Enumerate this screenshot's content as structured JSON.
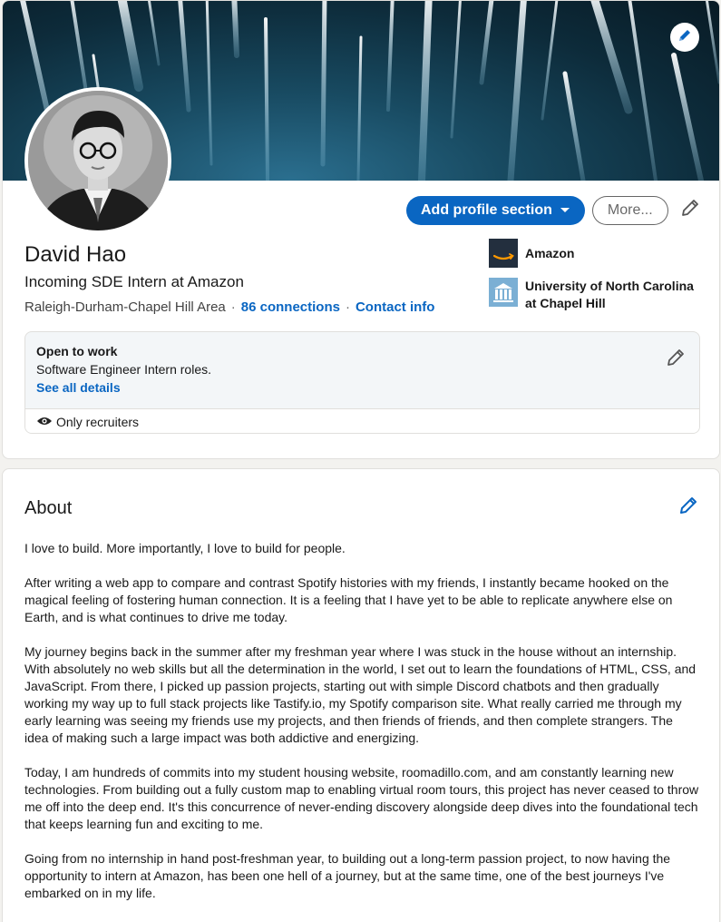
{
  "profile": {
    "name": "David Hao",
    "headline": "Incoming SDE Intern at Amazon",
    "location": "Raleigh-Durham-Chapel Hill Area",
    "connections": "86 connections",
    "contact_info": "Contact info"
  },
  "actions": {
    "add_section": "Add profile section",
    "more": "More..."
  },
  "orgs": [
    {
      "name": "Amazon",
      "icon": "amazon-logo"
    },
    {
      "name": "University of North Carolina at Chapel Hill",
      "icon": "unc-logo"
    }
  ],
  "open_to_work": {
    "title": "Open to work",
    "description": "Software Engineer Intern roles.",
    "link": "See all details",
    "visibility": "Only recruiters"
  },
  "about": {
    "title": "About",
    "paragraphs": [
      "I love to build. More importantly, I love to build for people.",
      "After writing a web app to compare and contrast Spotify histories with my friends, I instantly became hooked on the magical feeling of fostering human connection. It is a feeling that I have yet to be able to replicate anywhere else on Earth, and is what continues to drive me today.",
      "My journey begins back in the summer after my freshman year where I was stuck in the house without an internship. With absolutely no web skills but all the determination in the world, I set out to learn the foundations of HTML, CSS, and JavaScript. From there, I picked up passion projects, starting out with simple Discord chatbots and then gradually working my way up to full stack projects like Tastify.io, my Spotify comparison site. What really carried me through my early learning was seeing my friends use my projects, and then friends of friends, and then complete strangers. The idea of making such a large impact was both addictive and energizing.",
      "Today, I am hundreds of commits into my student housing website, roomadillo.com, and am constantly learning new technologies. From building out a fully custom map to enabling virtual room tours, this project has never ceased to throw me off into the deep end. It's this concurrence of never-ending discovery alongside deep dives into the foundational tech that keeps learning fun and exciting to me.",
      "Going from no internship in hand post-freshman year, to building out a long-term passion project, to now having the opportunity to intern at Amazon, has been one hell of a journey, but at the same time, one of the best journeys I've embarked on in my life."
    ]
  },
  "colors": {
    "accent": "#0a66c2",
    "background": "#f3f2ef",
    "card": "#ffffff"
  }
}
